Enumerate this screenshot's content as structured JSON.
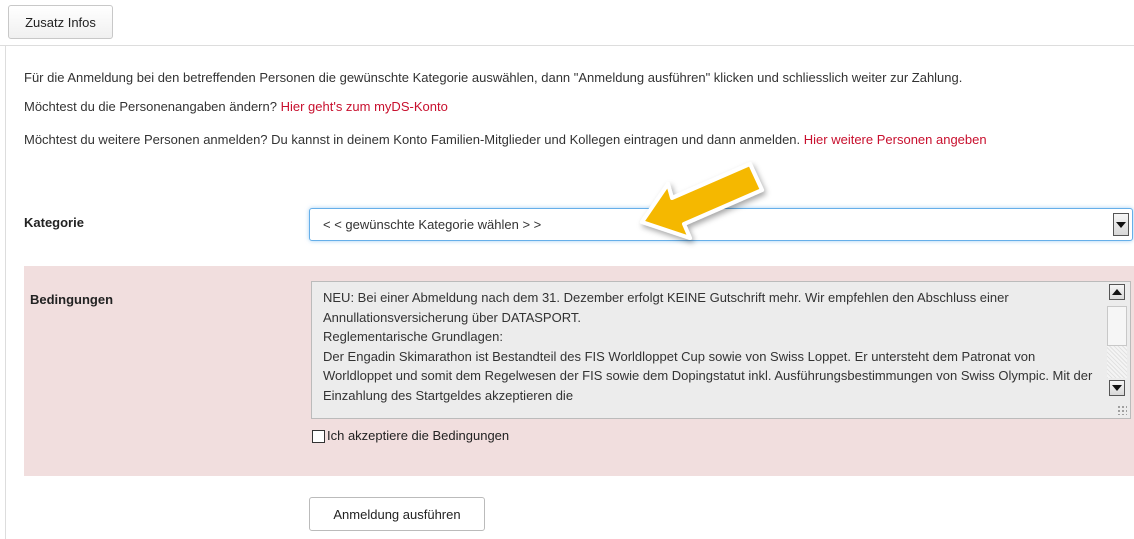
{
  "header": {
    "tab_button_label": "Zusatz Infos"
  },
  "intro": {
    "line1": "Für die Anmeldung bei den betreffenden Personen die gewünschte Kategorie auswählen, dann \"Anmeldung ausführen\" klicken und schliesslich weiter zur Zahlung.",
    "line2_text": "Möchtest du die Personenangaben ändern? ",
    "line2_link": "Hier geht's zum myDS-Konto",
    "line3_text": "Möchtest du weitere Personen anmelden? Du kannst in deinem Konto Familien-Mitglieder und Kollegen eintragen und dann anmelden. ",
    "line3_link": "Hier weitere Personen angeben"
  },
  "category": {
    "label": "Kategorie",
    "selected_value": "< < gewünschte Kategorie wählen > >"
  },
  "conditions": {
    "label": "Bedingungen",
    "text": "NEU: Bei einer Abmeldung nach dem 31. Dezember erfolgt KEINE Gutschrift mehr. Wir empfehlen den Abschluss einer Annullationsversicherung über DATASPORT.\nReglementarische Grundlagen:\nDer Engadin Skimarathon ist Bestandteil des FIS Worldloppet Cup sowie von Swiss Loppet. Er untersteht dem Patronat von Worldloppet und somit dem Regelwesen der FIS sowie dem Dopingstatut inkl. Ausführungsbestimmungen von Swiss Olympic. Mit der Einzahlung des Startgeldes akzeptieren die",
    "accept_label": "Ich akzeptiere die Bedingungen",
    "accepted": false
  },
  "actions": {
    "submit_label": "Anmeldung ausführen"
  },
  "colors": {
    "link": "#c8102e",
    "conditions_bg": "#f1dede",
    "pointer_arrow": "#f5b800"
  },
  "icons": {
    "pointer": "arrow-pointer-icon",
    "dropdown": "chevron-down-icon"
  }
}
